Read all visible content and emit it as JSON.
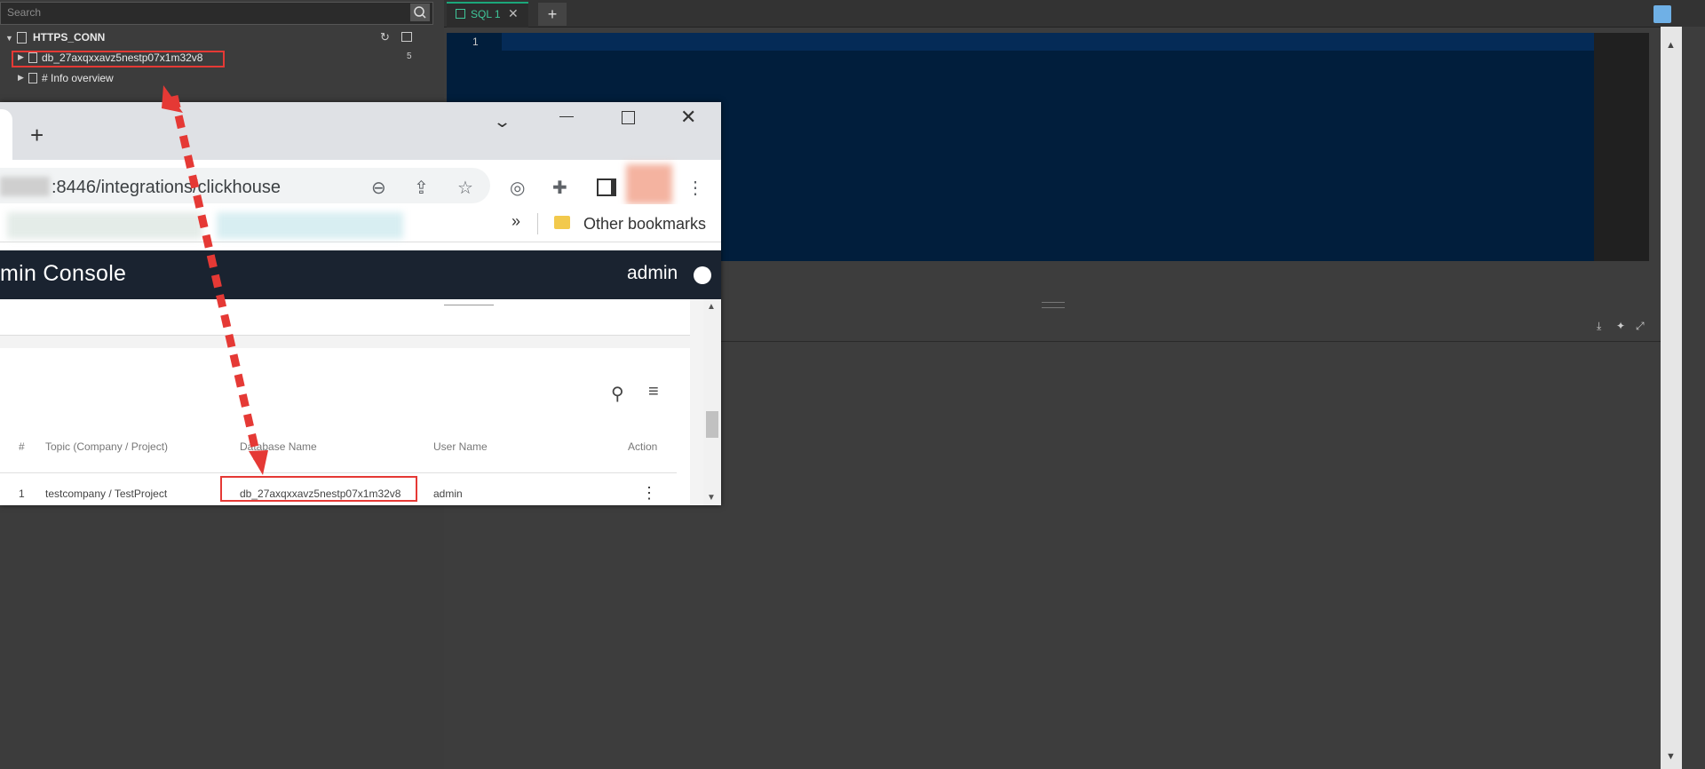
{
  "navigator": {
    "search_placeholder": "Search",
    "connection": {
      "name": "HTTPS_CONN"
    },
    "database": {
      "name": "db_27axqxxavz5nestp07x1m32v8",
      "count": "5"
    },
    "info": {
      "label": "# Info overview"
    }
  },
  "editor": {
    "tab_label": "SQL 1",
    "line_number": "1"
  },
  "browser": {
    "url": ":8446/integrations/clickhouse",
    "other_bookmarks": "Other bookmarks",
    "more_bookmarks": "»"
  },
  "app": {
    "title": "min Console",
    "user": "admin"
  },
  "table": {
    "headers": [
      "#",
      "Topic (Company / Project)",
      "Database Name",
      "User Name",
      "Action"
    ],
    "rows": [
      {
        "index": "1",
        "topic": "testcompany / TestProject",
        "database": "db_27axqxxavz5nestp07x1m32v8",
        "user": "admin"
      }
    ]
  },
  "colors": {
    "highlight": "#e53935",
    "arrow": "#e53935",
    "editor_bg": "#011e3c",
    "tab_accent": "#3fc79a"
  }
}
